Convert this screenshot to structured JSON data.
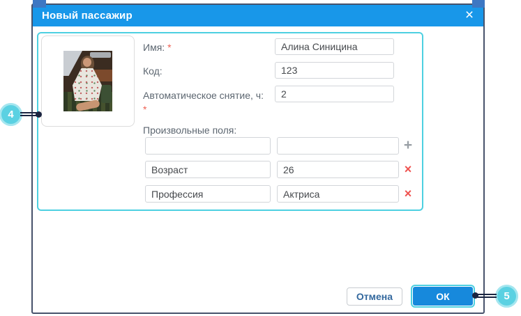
{
  "colors": {
    "header_blue": "#1897e9",
    "accent_cyan": "#4dd0e1",
    "ok_blue": "#1789dc",
    "callout_cyan": "#5bd1e2",
    "danger_red": "#ef5350",
    "border_navy": "#47526b"
  },
  "dialog": {
    "title": "Новый пассажир",
    "close_icon": "×",
    "form": {
      "name_label": "Имя:",
      "required_mark": "*",
      "name_value": "Алина Синицина",
      "code_label": "Код:",
      "code_value": "123",
      "auto_remove_label": "Автоматическое снятие, ч:",
      "auto_remove_value": "2",
      "custom_fields_label": "Произвольные поля:",
      "custom_rows": [
        {
          "name": "",
          "value": "",
          "action_icon": "+"
        },
        {
          "name": "Возраст",
          "value": "26",
          "action_icon": "×"
        },
        {
          "name": "Профессия",
          "value": "Актриса",
          "action_icon": "×"
        }
      ]
    },
    "footer": {
      "cancel_label": "Отмена",
      "ok_label": "ОК"
    }
  },
  "callouts": {
    "photo_number": "4",
    "ok_number": "5"
  }
}
